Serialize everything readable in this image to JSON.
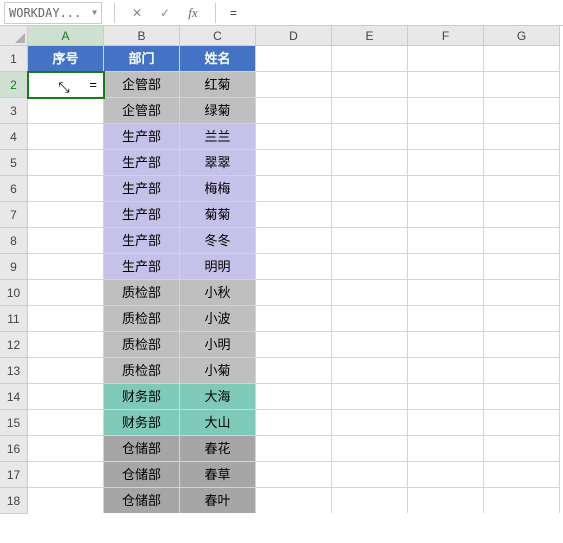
{
  "formula_bar": {
    "name_box": "WORKDAY...",
    "cancel": "✕",
    "confirm": "✓",
    "fx": "fx",
    "formula": "="
  },
  "columns": [
    "A",
    "B",
    "C",
    "D",
    "E",
    "F",
    "G"
  ],
  "active_col_index": 0,
  "active_row_index": 1,
  "rows": [
    "1",
    "2",
    "3",
    "4",
    "5",
    "6",
    "7",
    "8",
    "9",
    "10",
    "11",
    "12",
    "13",
    "14",
    "15",
    "16",
    "17",
    "18"
  ],
  "cells": {
    "headers": {
      "A": "序号",
      "B": "部门",
      "C": "姓名"
    },
    "A2": "=",
    "data": [
      {
        "B": "企管部",
        "C": "红菊",
        "cls": "grey"
      },
      {
        "B": "企管部",
        "C": "绿菊",
        "cls": "grey"
      },
      {
        "B": "生产部",
        "C": "兰兰",
        "cls": "lav"
      },
      {
        "B": "生产部",
        "C": "翠翠",
        "cls": "lav"
      },
      {
        "B": "生产部",
        "C": "梅梅",
        "cls": "lav"
      },
      {
        "B": "生产部",
        "C": "菊菊",
        "cls": "lav"
      },
      {
        "B": "生产部",
        "C": "冬冬",
        "cls": "lav"
      },
      {
        "B": "生产部",
        "C": "明明",
        "cls": "lav"
      },
      {
        "B": "质检部",
        "C": "小秋",
        "cls": "grey"
      },
      {
        "B": "质检部",
        "C": "小波",
        "cls": "grey"
      },
      {
        "B": "质检部",
        "C": "小明",
        "cls": "grey"
      },
      {
        "B": "质检部",
        "C": "小菊",
        "cls": "grey"
      },
      {
        "B": "财务部",
        "C": "大海",
        "cls": "teal"
      },
      {
        "B": "财务部",
        "C": "大山",
        "cls": "teal"
      },
      {
        "B": "仓储部",
        "C": "春花",
        "cls": "dgrey"
      },
      {
        "B": "仓储部",
        "C": "春草",
        "cls": "dgrey"
      },
      {
        "B": "仓储部",
        "C": "春叶",
        "cls": "dgrey"
      }
    ]
  },
  "chart_data": {
    "type": "table",
    "title": "",
    "columns": [
      "序号",
      "部门",
      "姓名"
    ],
    "rows": [
      [
        "",
        "企管部",
        "红菊"
      ],
      [
        "",
        "企管部",
        "绿菊"
      ],
      [
        "",
        "生产部",
        "兰兰"
      ],
      [
        "",
        "生产部",
        "翠翠"
      ],
      [
        "",
        "生产部",
        "梅梅"
      ],
      [
        "",
        "生产部",
        "菊菊"
      ],
      [
        "",
        "生产部",
        "冬冬"
      ],
      [
        "",
        "生产部",
        "明明"
      ],
      [
        "",
        "质检部",
        "小秋"
      ],
      [
        "",
        "质检部",
        "小波"
      ],
      [
        "",
        "质检部",
        "小明"
      ],
      [
        "",
        "质检部",
        "小菊"
      ],
      [
        "",
        "财务部",
        "大海"
      ],
      [
        "",
        "财务部",
        "大山"
      ],
      [
        "",
        "仓储部",
        "春花"
      ],
      [
        "",
        "仓储部",
        "春草"
      ],
      [
        "",
        "仓储部",
        "春叶"
      ]
    ]
  }
}
